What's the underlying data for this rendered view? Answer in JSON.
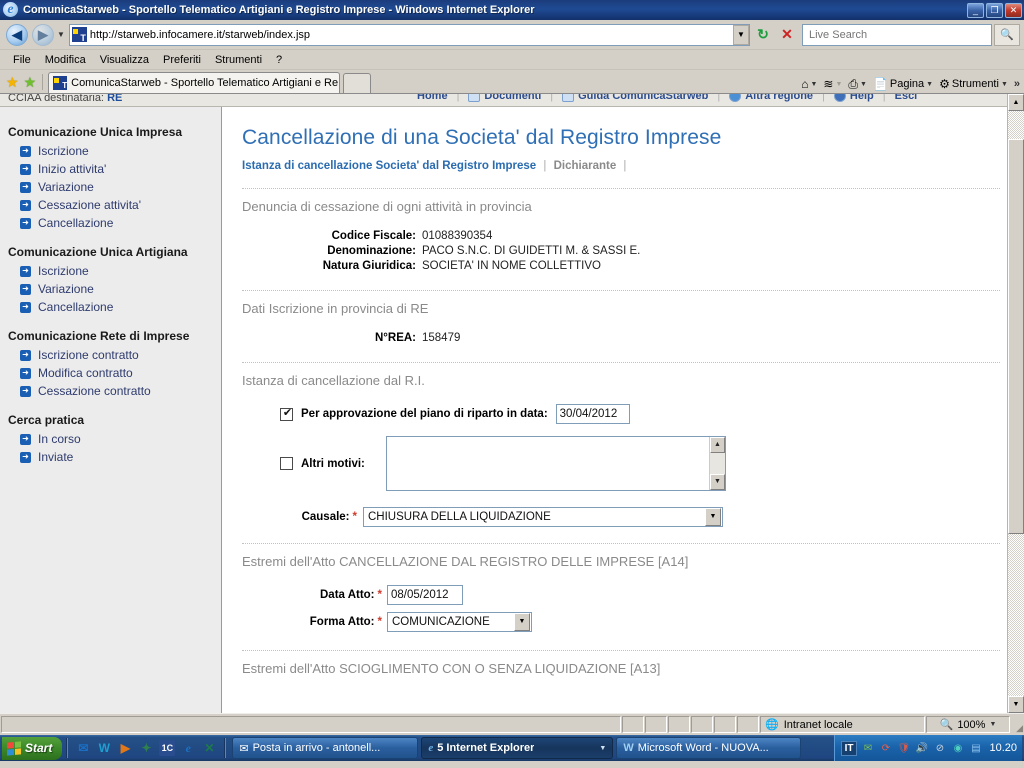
{
  "window": {
    "title": "ComunicaStarweb - Sportello Telematico Artigiani e Registro Imprese - Windows Internet Explorer",
    "minimize_label": "_",
    "maximize_label": "❐",
    "close_label": "✕"
  },
  "address_bar": {
    "back_label": "◀",
    "forward_label": "▶",
    "history_caret": "▼",
    "url": "http://starweb.infocamere.it/starweb/index.jsp",
    "url_dropdown": "▼",
    "refresh_label": "↻",
    "stop_label": "✕",
    "search_placeholder": "Live Search",
    "search_go": "🔍"
  },
  "menubar": {
    "items": [
      "File",
      "Modifica",
      "Visualizza",
      "Preferiti",
      "Strumenti",
      "?"
    ]
  },
  "tabbar": {
    "favorites_star": "★",
    "add_favorite_star": "★",
    "tab_title": "ComunicaStarweb - Sportello Telematico Artigiani e Re...",
    "newtab_label": "",
    "right_items": [
      {
        "name": "home",
        "glyph": "⌂",
        "label": "",
        "caret": "▼"
      },
      {
        "name": "feeds",
        "glyph": "≋",
        "label": "",
        "caret": "▼"
      },
      {
        "name": "print",
        "glyph": "⎙",
        "label": "",
        "caret": "▼"
      },
      {
        "name": "page",
        "glyph": "📄",
        "label": "Pagina",
        "caret": "▼"
      },
      {
        "name": "tools",
        "glyph": "⚙",
        "label": "Strumenti",
        "caret": "▼"
      }
    ],
    "overflow": "»"
  },
  "page_topbar": {
    "cciaa_label": "CCIAA destinataria:",
    "cciaa_value": "RE",
    "nav": [
      "Home",
      "Documenti",
      "Guida ComunicaStarweb",
      "Altra regione",
      "Help",
      "Esci"
    ]
  },
  "sidebar": {
    "groups": [
      {
        "heading": "Comunicazione Unica Impresa",
        "items": [
          "Iscrizione",
          "Inizio attivita'",
          "Variazione",
          "Cessazione attivita'",
          "Cancellazione"
        ]
      },
      {
        "heading": "Comunicazione Unica Artigiana",
        "items": [
          "Iscrizione",
          "Variazione",
          "Cancellazione"
        ]
      },
      {
        "heading": "Comunicazione Rete di Imprese",
        "items": [
          "Iscrizione contratto",
          "Modifica contratto",
          "Cessazione contratto"
        ]
      },
      {
        "heading": "Cerca pratica",
        "items": [
          "In corso",
          "Inviate"
        ]
      }
    ]
  },
  "main": {
    "page_title": "Cancellazione di una Societa' dal Registro Imprese",
    "breadcrumb": {
      "current": "Istanza di cancellazione Societa' dal Registro Imprese",
      "separator": "|",
      "next": "Dichiarante",
      "trailing": "|"
    },
    "section_denuncia": {
      "title": "Denuncia di cessazione di ogni attività in provincia",
      "fields": [
        {
          "label": "Codice Fiscale:",
          "value": "01088390354"
        },
        {
          "label": "Denominazione:",
          "value": "PACO S.N.C. DI GUIDETTI M. & SASSI E."
        },
        {
          "label": "Natura Giuridica:",
          "value": "SOCIETA' IN NOME COLLETTIVO"
        }
      ]
    },
    "section_dati": {
      "title": "Dati Iscrizione in provincia di RE",
      "fields": [
        {
          "label": "N°REA:",
          "value": "158479"
        }
      ]
    },
    "section_istanza": {
      "title": "Istanza di cancellazione dal R.I.",
      "checkbox_riparto": {
        "label": "Per approvazione del piano di riparto in data:",
        "checked": true,
        "date_value": "30/04/2012"
      },
      "checkbox_altri": {
        "label": "Altri motivi:",
        "checked": false,
        "textarea_value": "",
        "scroll_up": "▲",
        "scroll_down": "▼"
      },
      "causale": {
        "label": "Causale:",
        "required": "*",
        "value": "CHIUSURA DELLA LIQUIDAZIONE",
        "caret": "▼"
      }
    },
    "section_atto_a14": {
      "title": "Estremi dell'Atto CANCELLAZIONE DAL REGISTRO DELLE IMPRESE [A14]",
      "data_atto": {
        "label": "Data Atto:",
        "required": "*",
        "value": "08/05/2012"
      },
      "forma_atto": {
        "label": "Forma Atto:",
        "required": "*",
        "value": "COMUNICAZIONE",
        "caret": "▼"
      }
    },
    "section_atto_a13": {
      "title": "Estremi dell'Atto SCIOGLIMENTO CON O SENZA LIQUIDAZIONE [A13]"
    },
    "scrollbar": {
      "up": "▲",
      "down": "▼"
    }
  },
  "statusbar": {
    "message": "",
    "zone": "Intranet locale",
    "zone_icon": "🌐",
    "zoom": "100%",
    "zoom_icon": "🔍",
    "zoom_caret": "▼"
  },
  "taskbar": {
    "start_label": "Start",
    "quick_launch": [
      {
        "name": "mail-icon",
        "glyph": "✉",
        "color": "#1a6fc4"
      },
      {
        "name": "word-icon",
        "glyph": "W",
        "color": "#1f9fd0"
      },
      {
        "name": "media-player-icon",
        "glyph": "▶",
        "color": "#e0781a"
      },
      {
        "name": "messenger-icon",
        "glyph": "✦",
        "color": "#2f7f4f"
      },
      {
        "name": "tc-icon",
        "glyph": "1C",
        "color": "#2a4d8f"
      },
      {
        "name": "internet-explorer-icon",
        "glyph": "e",
        "color": "#1b6fc0"
      },
      {
        "name": "excel-icon",
        "glyph": "✕",
        "color": "#1e7a4a"
      }
    ],
    "tasks": [
      {
        "label": "Posta in arrivo - antonell...",
        "icon": "✉",
        "active": false,
        "caret": ""
      },
      {
        "label": "5 Internet Explorer",
        "icon": "e",
        "active": true,
        "caret": "▼"
      },
      {
        "label": "Microsoft Word - NUOVA...",
        "icon": "W",
        "active": false,
        "caret": ""
      }
    ],
    "tray": {
      "language": "IT",
      "icons": [
        {
          "name": "mail-tray-icon",
          "glyph": "✉",
          "color": "#7fbf4f"
        },
        {
          "name": "sync-tray-icon",
          "glyph": "⟳",
          "color": "#cc3b2a"
        },
        {
          "name": "antivirus-tray-icon",
          "glyph": "🛡",
          "color": "#c0392b"
        },
        {
          "name": "volume-tray-icon",
          "glyph": "🔊",
          "color": "#d35400"
        },
        {
          "name": "block-tray-icon",
          "glyph": "⊘",
          "color": "#7f8c8d"
        },
        {
          "name": "display-tray-icon",
          "glyph": "◉",
          "color": "#16a085"
        },
        {
          "name": "network-tray-icon",
          "glyph": "▤",
          "color": "#2980b9"
        }
      ],
      "clock": "10.20"
    }
  }
}
